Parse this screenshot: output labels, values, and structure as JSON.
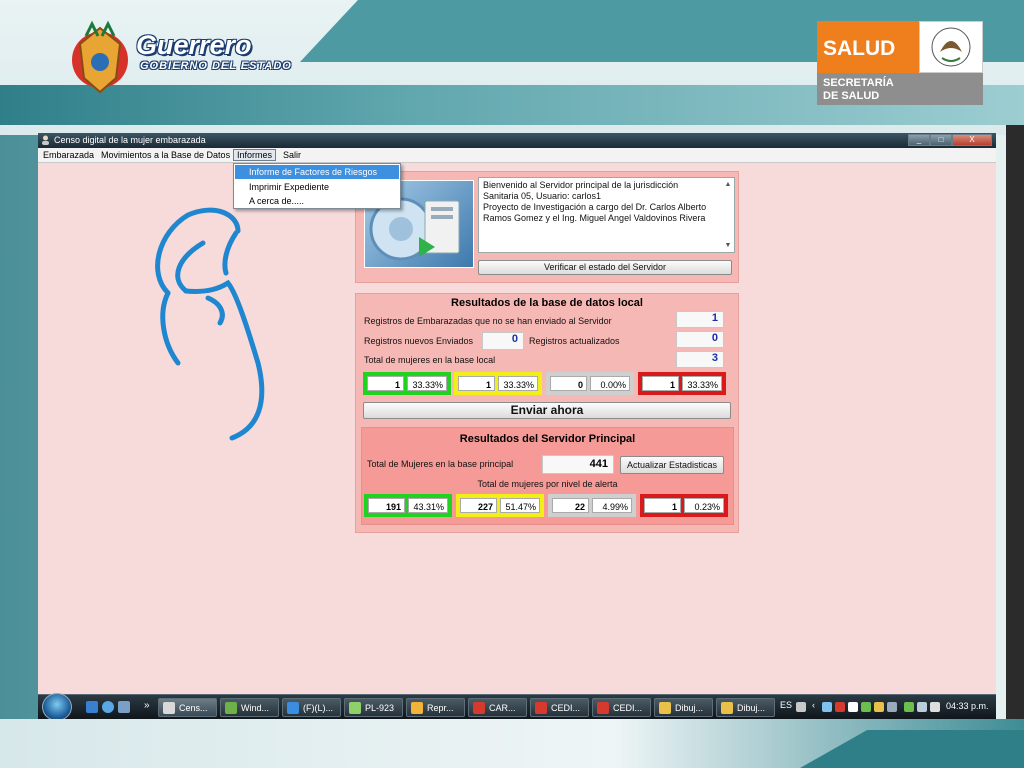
{
  "header": {
    "brand_title": "Guerrero",
    "brand_subtitle": "GOBIERNO DEL ESTADO",
    "salud_title": "SALUD",
    "salud_line1": "SECRETARÍA",
    "salud_line2": "DE SALUD"
  },
  "window": {
    "title": "Censo digital de la mujer embarazada",
    "controls": [
      "_",
      "□",
      "X"
    ]
  },
  "menubar": {
    "items": [
      {
        "label": "Embarazada"
      },
      {
        "label": "Movimientos a la Base de Datos"
      },
      {
        "label": "Informes"
      },
      {
        "label": "Salir"
      }
    ]
  },
  "informes_menu": {
    "items": [
      {
        "label": "Informe de Factores de Riesgos"
      },
      {
        "label": "Imprimir Expediente"
      },
      {
        "label": "A cerca de....."
      }
    ]
  },
  "server": {
    "welcome_line1": "Bienvenido al Servidor principal de la jurisdicción",
    "welcome_line2": "Sanitaria 05, Usuario: carlos1",
    "welcome_line3": "Proyecto de Investigación a cargo del Dr. Carlos Alberto",
    "welcome_line4": "Ramos Gomez y el Ing. Miguel Angel Valdovinos Rivera",
    "verify_button": "Verificar el estado del Servidor"
  },
  "local": {
    "title": "Resultados de la base de datos local",
    "pending_label": "Registros de Embarazadas que no se han enviado al Servidor",
    "pending_value": "1",
    "new_sent_label": "Registros nuevos Enviados",
    "new_sent_value": "0",
    "updated_label": "Registros actualizados",
    "updated_value": "0",
    "total_label": "Total de mujeres en la base local",
    "total_value": "3",
    "stats": [
      {
        "count": "1",
        "percent": "33.33%",
        "color": "#21d221"
      },
      {
        "count": "1",
        "percent": "33.33%",
        "color": "#f2ee18"
      },
      {
        "count": "0",
        "percent": "0.00%",
        "color": "#cfcfcf"
      },
      {
        "count": "1",
        "percent": "33.33%",
        "color": "#d81a1a"
      }
    ],
    "send_button": "Enviar ahora"
  },
  "principal": {
    "title": "Resultados del Servidor Principal",
    "total_label": "Total de Mujeres en la base principal",
    "total_value": "441",
    "update_button": "Actualizar Estadisticas",
    "alert_label": "Total de mujeres por nivel de alerta",
    "stats": [
      {
        "count": "191",
        "percent": "43.31%",
        "color": "#21d221"
      },
      {
        "count": "227",
        "percent": "51.47%",
        "color": "#f2ee18"
      },
      {
        "count": "22",
        "percent": "4.99%",
        "color": "#cfcfcf"
      },
      {
        "count": "1",
        "percent": "0.23%",
        "color": "#d81a1a"
      }
    ]
  },
  "taskbar": {
    "more": "»",
    "buttons": [
      {
        "label": "Cens...",
        "icon": "user-icon",
        "color": "#d9d9d9"
      },
      {
        "label": "Wind...",
        "icon": "windows-icon",
        "color": "#6fb04a"
      },
      {
        "label": "(F)(L)...",
        "icon": "messenger-icon",
        "color": "#3a8de0"
      },
      {
        "label": "PL-923",
        "icon": "folder-icon",
        "color": "#8ed16b"
      },
      {
        "label": "Repr...",
        "icon": "media-icon",
        "color": "#f2b33a"
      },
      {
        "label": "CAR...",
        "icon": "pdf-icon",
        "color": "#d63a2f"
      },
      {
        "label": "CEDI...",
        "icon": "pdf-icon",
        "color": "#d63a2f"
      },
      {
        "label": "CEDI...",
        "icon": "pdf-icon",
        "color": "#d63a2f"
      },
      {
        "label": "Dibuj...",
        "icon": "paint-icon",
        "color": "#e8c04a"
      },
      {
        "label": "Dibuj...",
        "icon": "paint-icon",
        "color": "#e8c04a"
      }
    ],
    "language": "ES",
    "clock": "04:33 p.m."
  }
}
